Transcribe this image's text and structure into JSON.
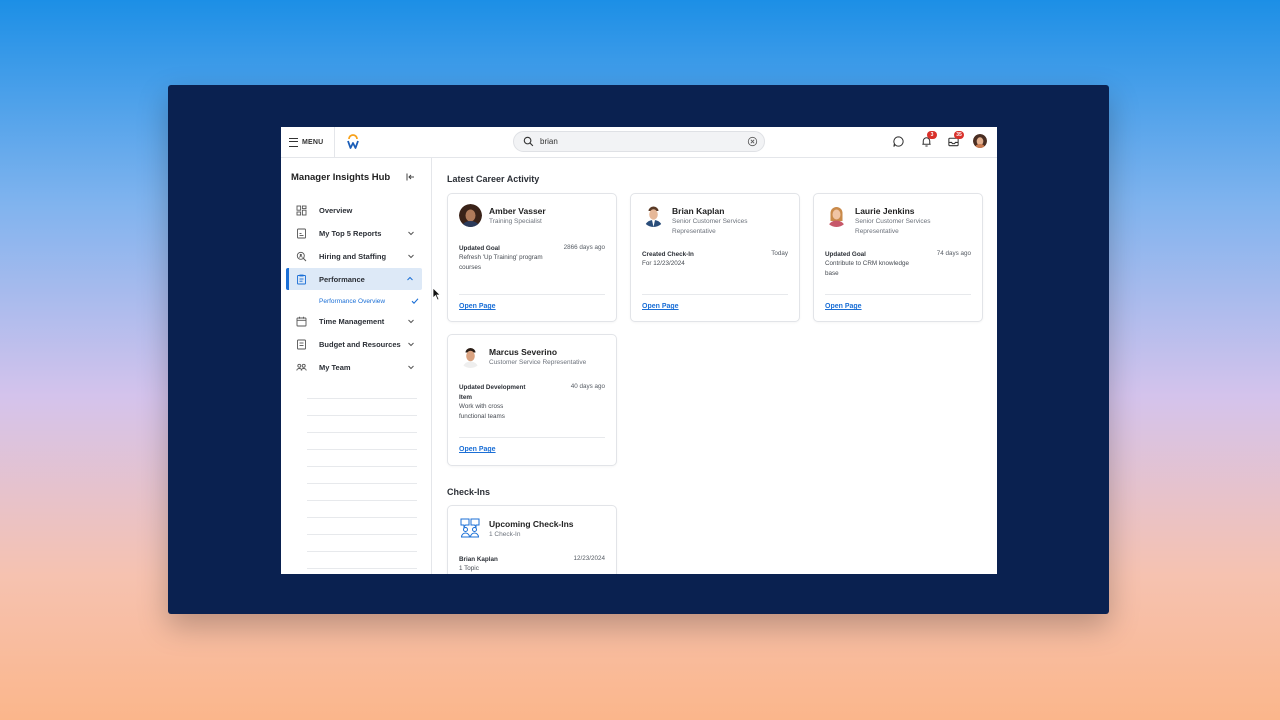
{
  "topbar": {
    "menu_label": "MENU",
    "search_value": "brian",
    "notifications_count": "3",
    "inbox_count": "35"
  },
  "sidebar": {
    "title": "Manager Insights Hub",
    "items": [
      {
        "label": "Overview",
        "icon": "grid-icon"
      },
      {
        "label": "My Top 5 Reports",
        "icon": "report-icon"
      },
      {
        "label": "Hiring and Staffing",
        "icon": "search-person-icon"
      },
      {
        "label": "Performance",
        "icon": "clipboard-icon",
        "active": true
      },
      {
        "label": "Time Management",
        "icon": "calendar-icon"
      },
      {
        "label": "Budget and Resources",
        "icon": "document-icon"
      },
      {
        "label": "My Team",
        "icon": "team-icon"
      }
    ],
    "sub_item": {
      "label": "Performance Overview"
    }
  },
  "main": {
    "career_title": "Latest Career Activity",
    "cards": [
      {
        "name": "Amber Vasser",
        "role": "Training Specialist",
        "activity": "Updated Goal",
        "time": "2866 days ago",
        "desc": "Refresh 'Up Training' program courses",
        "link": "Open Page"
      },
      {
        "name": "Brian Kaplan",
        "role": "Senior Customer Services Representative",
        "activity": "Created Check-In",
        "time": "Today",
        "desc": "For 12/23/2024",
        "link": "Open Page"
      },
      {
        "name": "Laurie Jenkins",
        "role": "Senior Customer Services Representative",
        "activity": "Updated Goal",
        "time": "74 days ago",
        "desc": "Contribute to CRM knowledge base",
        "link": "Open Page"
      },
      {
        "name": "Marcus Severino",
        "role": "Customer Service Representative",
        "activity": "Updated Development Item",
        "time": "40 days ago",
        "desc": "Work with cross functional teams",
        "link": "Open Page"
      }
    ],
    "checkins_title": "Check-Ins",
    "checkin_card": {
      "title": "Upcoming Check-Ins",
      "subtitle": "1 Check-In",
      "person": "Brian Kaplan",
      "date": "12/23/2024",
      "topics": "1 Topic"
    }
  },
  "colors": {
    "accent": "#1b6fd6",
    "active_bg": "#dde9f7",
    "frame": "#0a2150",
    "badge": "#d9312b"
  }
}
